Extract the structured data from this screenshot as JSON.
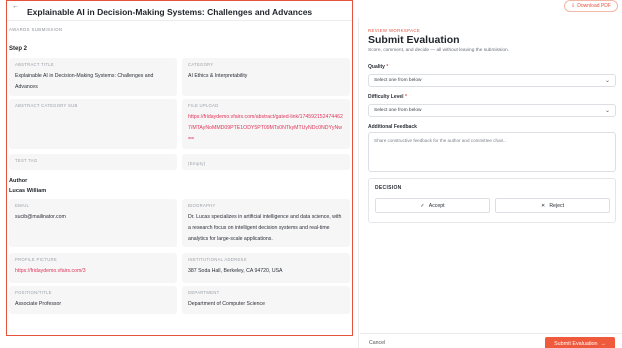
{
  "submission": {
    "back_icon": "arrow-left-icon",
    "title": "Explainable AI in Decision-Making Systems: Challenges and Advances",
    "eyebrow": "Awards Submission",
    "step": "Step 2",
    "fields": {
      "abstract_title": {
        "label": "Abstract Title",
        "value": "Explainable AI in Decision-Making Systems: Challenges and Advances"
      },
      "category": {
        "label": "Category",
        "value": "AI Ethics & Interpretability"
      },
      "abstract_category_sub": {
        "label": "Abstract Category Sub",
        "value": ""
      },
      "file_upload": {
        "label": "File Upload",
        "value": "https://fridaydemo.vfairs.com/abstract/gated-link/1745921524744627/MTAyNoMMD09PTE1ODY5PT09MTs0NTkyMTUyNDc0NDYyNw=="
      },
      "test_tag": {
        "label": "Test Tag",
        "value": ""
      },
      "test_tag_value": {
        "label": "",
        "value": "(Empty)"
      }
    },
    "author_heading": "Author",
    "author_name": "Lucas William",
    "author_fields": {
      "email": {
        "label": "Email",
        "value": "sucib@mailinator.com"
      },
      "biography": {
        "label": "Biography",
        "value": "Dr. Lucas specializes in artificial intelligence and data science, with a research focus on intelligent decision systems and real-time analytics for large-scale applications."
      },
      "profile_picture": {
        "label": "Profile Picture",
        "value": "https://fridaydemo.vfairs.com/3"
      },
      "institutional_address": {
        "label": "Institutional Address",
        "value": "387 Soda Hall, Berkeley, CA 94720, USA"
      },
      "position_title": {
        "label": "Position/Title",
        "value": "Associate Professor"
      },
      "department": {
        "label": "Department",
        "value": "Department of Computer Science"
      }
    }
  },
  "evaluation": {
    "download_pdf": "Download PDF",
    "download_icon": "download-icon",
    "eyebrow": "Review Workspace",
    "title": "Submit Evaluation",
    "subtitle": "Score, comment, and decide — all without leaving the submission.",
    "quality_label": "Quality",
    "quality_value": "Select one from below",
    "difficulty_label": "Difficulty Level",
    "difficulty_value": "Select one from below",
    "required_mark": "*",
    "feedback_label": "Additional Feedback",
    "feedback_placeholder": "Share constructive feedback for the author and committee chair...",
    "decision_label": "Decision",
    "accept_label": "Accept",
    "reject_label": "Reject",
    "cancel_label": "Cancel",
    "submit_label": "Submit Evaluation",
    "accent_color": "#ef5a3c"
  }
}
